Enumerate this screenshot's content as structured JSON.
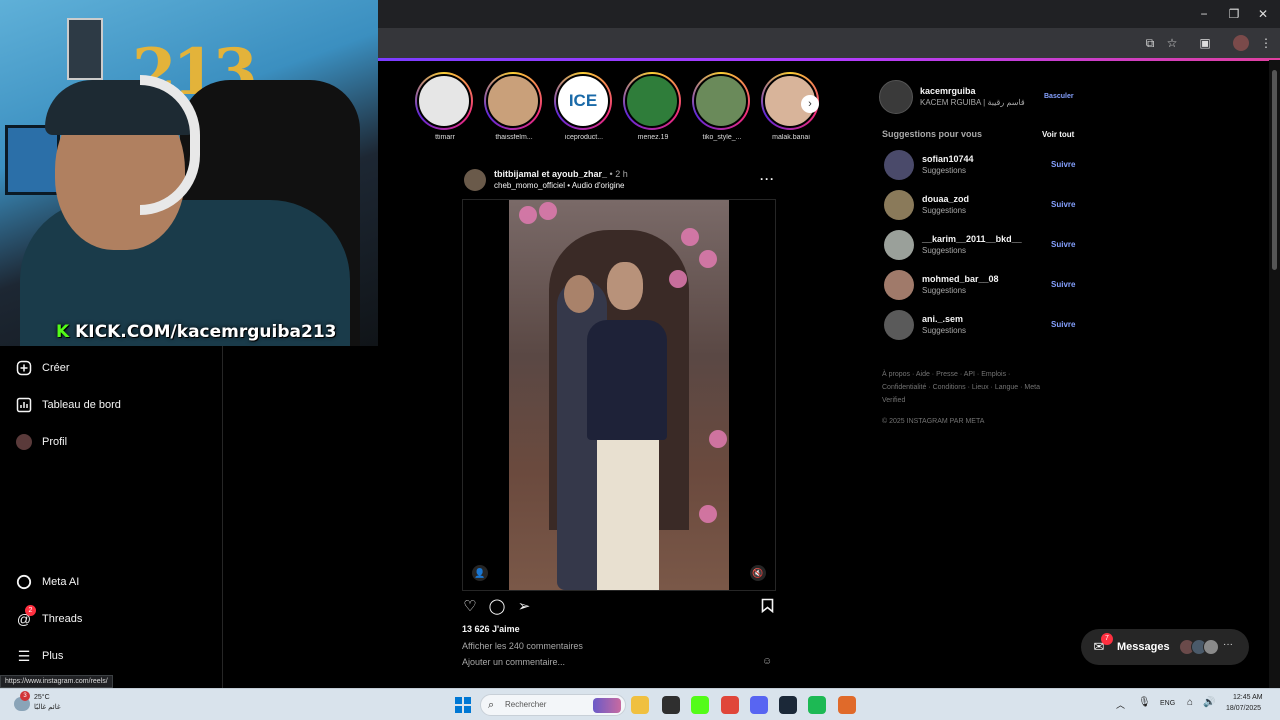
{
  "browser": {
    "status_url": "https://www.instagram.com/reels/",
    "window_controls": [
      "minimize-icon",
      "restore-icon",
      "close-icon"
    ],
    "toolbar_icons": [
      "install-icon",
      "star-icon",
      "extensions-icon",
      "profile-icon",
      "menu-icon"
    ]
  },
  "stream": {
    "kick_prefix": "K",
    "kick_url": "KICK.COM/kacemrguiba213",
    "balloon_text": "213"
  },
  "nav": {
    "items": [
      {
        "label": "Créer",
        "icon": "plus-square-icon"
      },
      {
        "label": "Tableau de bord",
        "icon": "dashboard-icon"
      },
      {
        "label": "Profil",
        "icon": "avatar-icon"
      },
      {
        "label": "Meta AI",
        "icon": "meta-ai-icon"
      },
      {
        "label": "Threads",
        "icon": "threads-icon",
        "badge": "2"
      },
      {
        "label": "Plus",
        "icon": "hamburger-icon"
      }
    ]
  },
  "stories": [
    {
      "label": "ttimarr",
      "color": "#e6e6e6"
    },
    {
      "label": "thaissfelm...",
      "color": "#c9a07a"
    },
    {
      "label": "iceproduct...",
      "color": "#ffffff",
      "text": "ICE"
    },
    {
      "label": "menez.19",
      "color": "#2f7d3a"
    },
    {
      "label": "tiko_style_...",
      "color": "#6a8a5a"
    },
    {
      "label": "malak.banai",
      "color": "#d8b49a"
    }
  ],
  "post": {
    "users": "tbitbijamal et ayoub_zhar_",
    "time": "• 2 h",
    "audio_user": "cheb_momo_officiel",
    "audio_label": "• Audio d'origine",
    "likes": "13 626 J'aime",
    "comments_link": "Afficher les 240 commentaires",
    "add_comment": "Ajouter un commentaire..."
  },
  "sidebar": {
    "me_username": "kacemrguiba",
    "me_fullname": "KACEM RGUIBA | قاسم رقيبة",
    "switch_label": "Basculer",
    "suggestions_title": "Suggestions pour vous",
    "see_all": "Voir tout",
    "suggestions": [
      {
        "username": "sofian10744",
        "sub": "Suggestions",
        "follow": "Suivre",
        "color": "#4a4a6a"
      },
      {
        "username": "douaa_zod",
        "sub": "Suggestions",
        "follow": "Suivre",
        "color": "#8a7a5a"
      },
      {
        "username": "__karim__2011__bkd__",
        "sub": "Suggestions",
        "follow": "Suivre",
        "color": "#9aa09a"
      },
      {
        "username": "mohmed_bar__08",
        "sub": "Suggestions",
        "follow": "Suivre",
        "color": "#a07a6a"
      },
      {
        "username": "ani._.sem",
        "sub": "Suggestions",
        "follow": "Suivre",
        "color": "#5a5a5a"
      }
    ],
    "footer_links": "À propos · Aide · Presse · API · Emplois · Confidentialité · Conditions · Lieux · Langue · Meta Verified",
    "copyright": "© 2025 INSTAGRAM PAR META"
  },
  "messages": {
    "label": "Messages",
    "badge": "7"
  },
  "taskbar": {
    "weather_temp": "25°C",
    "weather_desc": "غائم غالبًا",
    "weather_badge": "3",
    "search_placeholder": "Rechercher",
    "lang": "ENG",
    "time": "12:45 AM",
    "date": "18/07/2025",
    "apps": [
      {
        "name": "file-explorer-icon",
        "color": "#f0c040"
      },
      {
        "name": "task-view-icon",
        "color": "#2f2f2f"
      },
      {
        "name": "kick-app-icon",
        "color": "#53fc18"
      },
      {
        "name": "chrome-icon",
        "color": "#e0463a"
      },
      {
        "name": "discord-icon",
        "color": "#5865f2"
      },
      {
        "name": "steam-icon",
        "color": "#1b2838"
      },
      {
        "name": "spotify-icon",
        "color": "#1db954"
      },
      {
        "name": "app-icon",
        "color": "#e06a2a"
      }
    ]
  }
}
